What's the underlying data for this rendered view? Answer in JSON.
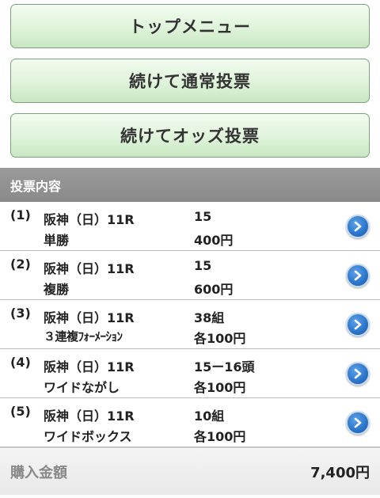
{
  "menu": {
    "top_menu": "トップメニュー",
    "continue_normal": "続けて通常投票",
    "continue_odds": "続けてオッズ投票"
  },
  "section": {
    "title": "投票内容"
  },
  "tickets": [
    {
      "num": "(1)",
      "race": "阪神（日）11R",
      "type": "単勝",
      "horses": "15",
      "amount": "400円"
    },
    {
      "num": "(2)",
      "race": "阪神（日）11R",
      "type": "複勝",
      "horses": "15",
      "amount": "600円"
    },
    {
      "num": "(3)",
      "race": "阪神（日）11R",
      "type": "３連複ﾌｫｰﾒｰｼｮﾝ",
      "horses": "38組",
      "amount": "各100円"
    },
    {
      "num": "(4)",
      "race": "阪神（日）11R",
      "type": "ワイドながし",
      "horses": "15ー16頭",
      "amount": "各100円"
    },
    {
      "num": "(5)",
      "race": "阪神（日）11R",
      "type": "ワイドボックス",
      "horses": "10組",
      "amount": "各100円"
    }
  ],
  "total": {
    "label": "購入金額",
    "value": "7,400円"
  },
  "colors": {
    "button_green": "#dff3da",
    "header_gray": "#8f8f8f",
    "chevron_blue": "#2a74c9"
  }
}
